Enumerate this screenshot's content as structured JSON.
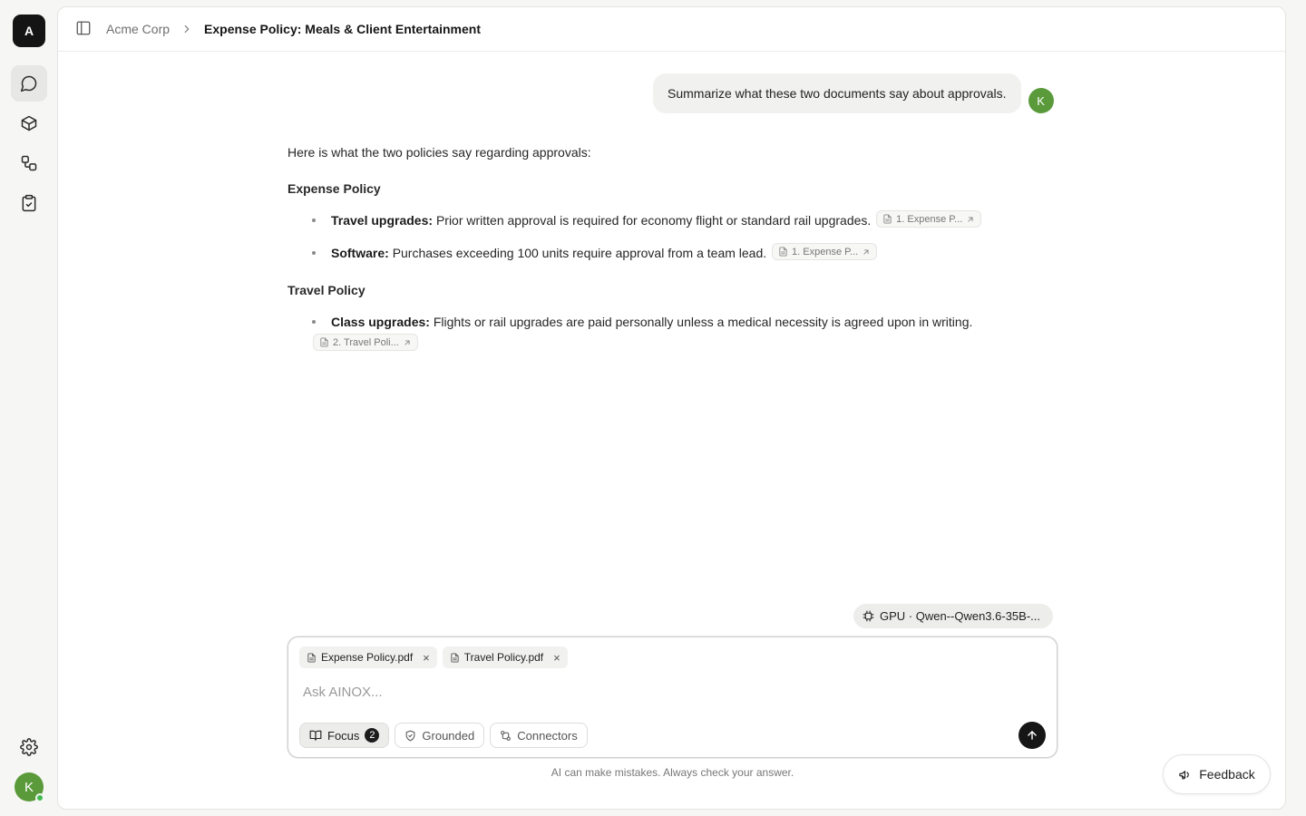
{
  "rail": {
    "logo_letter": "A",
    "items": [
      {
        "name": "chat",
        "icon": "chat-bubble-icon",
        "active": true
      },
      {
        "name": "models",
        "icon": "cube-icon",
        "active": false
      },
      {
        "name": "workflows",
        "icon": "workflow-icon",
        "active": false
      },
      {
        "name": "tasks",
        "icon": "clipboard-check-icon",
        "active": false
      }
    ],
    "settings_icon": "gear-icon",
    "user_initial": "K"
  },
  "header": {
    "org": "Acme Corp",
    "title": "Expense Policy: Meals & Client Entertainment"
  },
  "conversation": {
    "user_message": "Summarize what these two documents say about approvals.",
    "user_initial": "K",
    "answer": {
      "intro": "Here is what the two policies say regarding approvals:",
      "sections": [
        {
          "heading": "Expense Policy",
          "items": [
            {
              "label": "Travel upgrades:",
              "text": "Prior written approval is required for economy flight or standard rail upgrades.",
              "citation": "1. Expense P..."
            },
            {
              "label": "Software:",
              "text": "Purchases exceeding 100 units require approval from a team lead.",
              "citation": "1. Expense P..."
            }
          ]
        },
        {
          "heading": "Travel Policy",
          "items": [
            {
              "label": "Class upgrades:",
              "text": "Flights or rail upgrades are paid personally unless a medical necessity is agreed upon in writing.",
              "citation": "2. Travel Poli..."
            }
          ]
        }
      ]
    }
  },
  "model_chip": "GPU · Qwen--Qwen3.6-35B-...",
  "composer": {
    "attachments": [
      "Expense Policy.pdf",
      "Travel Policy.pdf"
    ],
    "placeholder": "Ask AINOX...",
    "value": "",
    "tools": {
      "focus": "Focus",
      "focus_count": "2",
      "grounded": "Grounded",
      "connectors": "Connectors"
    }
  },
  "disclaimer": "AI can make mistakes. Always check your answer.",
  "feedback": "Feedback"
}
